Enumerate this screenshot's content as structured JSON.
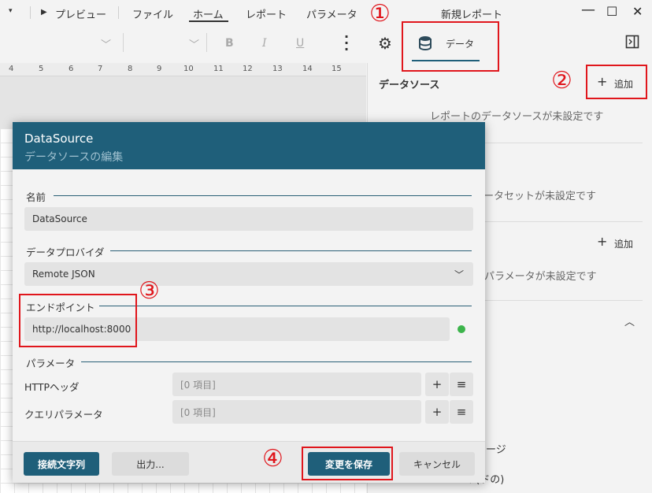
{
  "menubar": {
    "preview": "プレビュー",
    "file": "ファイル",
    "home": "ホーム",
    "report": "レポート",
    "parameters": "パラメータ",
    "window_title": "新規レポート"
  },
  "toolbar": {
    "bold": "B",
    "italic": "I",
    "underline": "U",
    "data_tab": "データ"
  },
  "ruler": [
    "4",
    "5",
    "6",
    "7",
    "8",
    "9",
    "10",
    "11",
    "12",
    "13",
    "14",
    "15"
  ],
  "right_panel": {
    "datasource_title": "データソース",
    "add": "追加",
    "no_datasource": "レポートのデータソースが未設定です",
    "no_dataset_partial": "ータセットが未設定です",
    "add2": "追加",
    "no_params_partial": "パラメータが未設定です",
    "partial_1": "ージ",
    "partial_2": "コ (ドの)"
  },
  "annotations": [
    "①",
    "②",
    "③",
    "④"
  ],
  "dialog": {
    "title": "DataSource",
    "subtitle": "データソースの編集",
    "name_label": "名前",
    "name_value": "DataSource",
    "provider_label": "データプロバイダ",
    "provider_value": "Remote JSON",
    "endpoint_label": "エンドポイント",
    "endpoint_value": "http://localhost:8000",
    "params_label": "パラメータ",
    "http_headers_label": "HTTPヘッダ",
    "http_headers_value": "[0 項目]",
    "query_params_label": "クエリパラメータ",
    "query_params_value": "[0 項目]",
    "connection_string_button": "接続文字列",
    "output_button": "出力...",
    "save_button": "変更を保存",
    "cancel_button": "キャンセル",
    "status_color": "#3cb44b"
  }
}
